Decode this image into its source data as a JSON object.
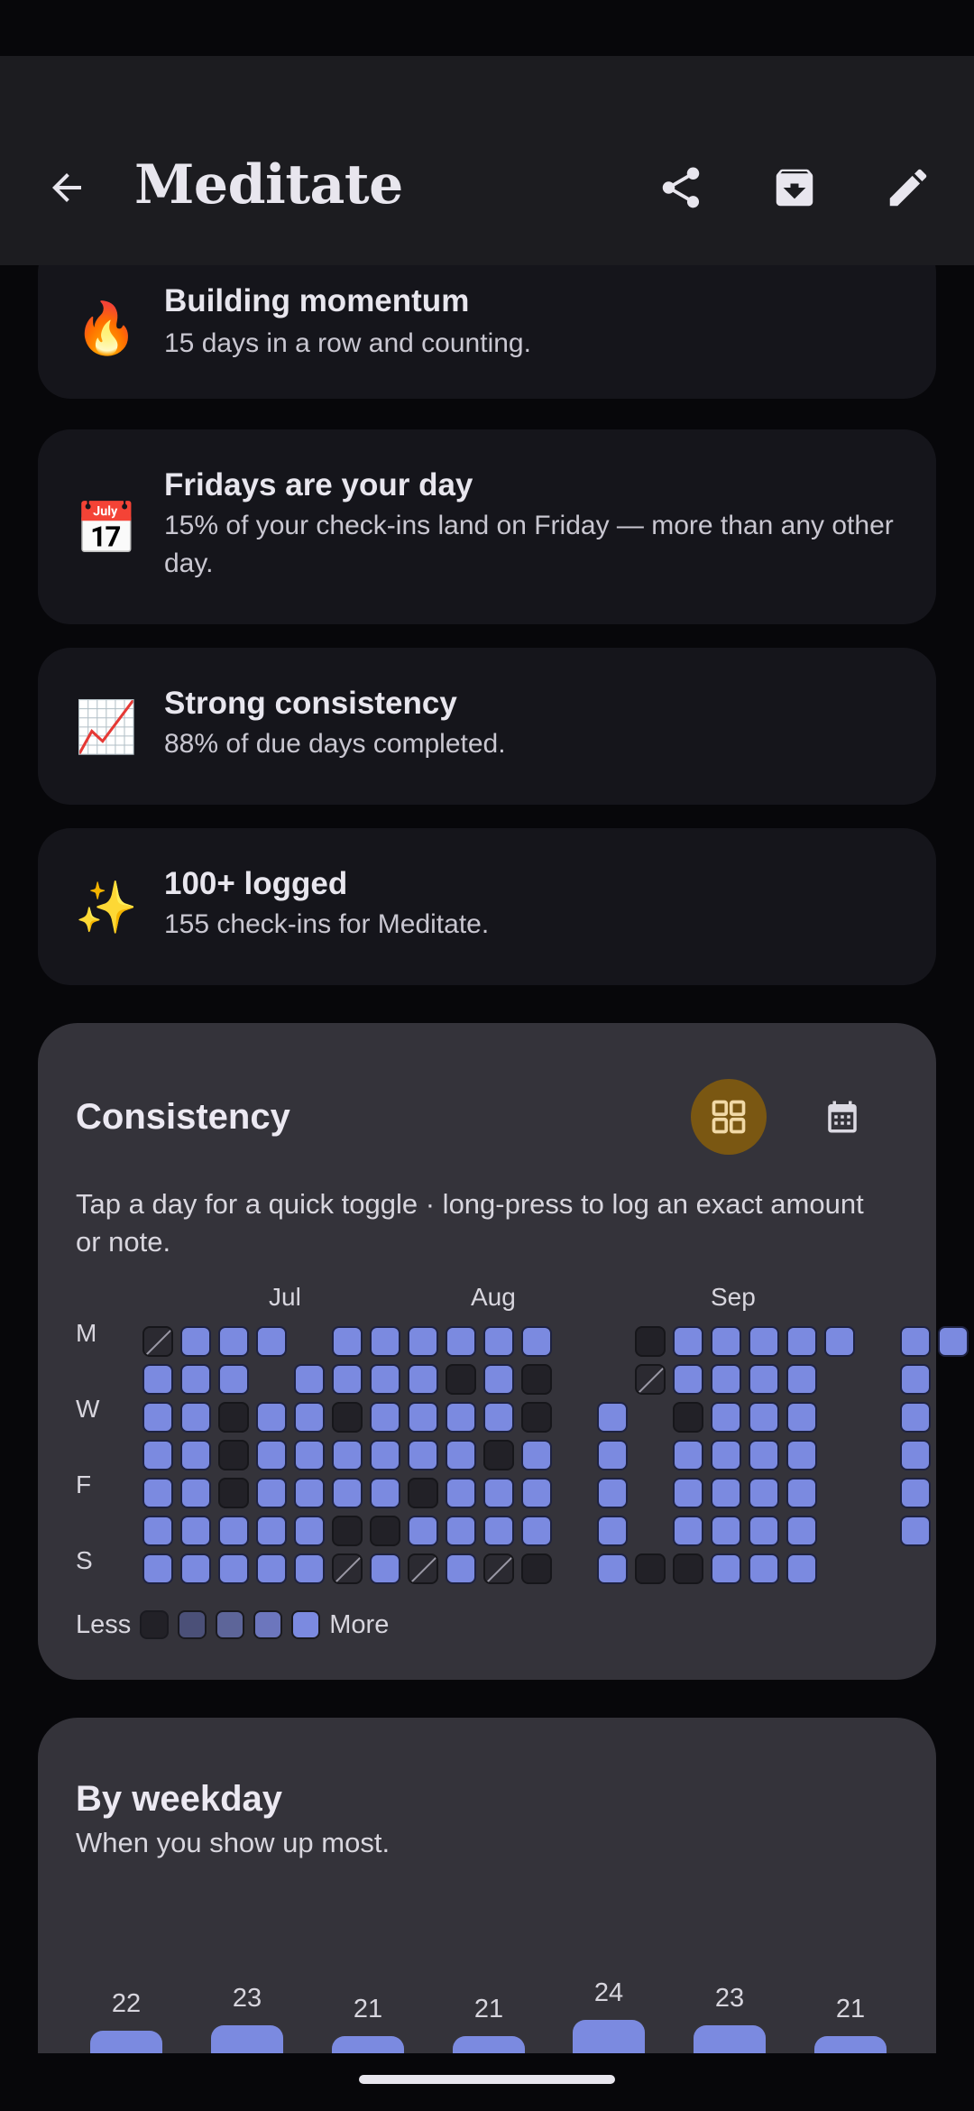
{
  "app_bar": {
    "title": "Meditate",
    "back_icon": "arrow-back-icon",
    "actions": [
      "share-icon",
      "archive-icon",
      "edit-icon"
    ]
  },
  "insights": [
    {
      "icon": "fire-icon",
      "emoji": "🔥",
      "title": "Building momentum",
      "desc": "15 days in a row and counting."
    },
    {
      "icon": "calendar-icon",
      "emoji": "📅",
      "title": "Fridays are your day",
      "desc": "15% of your check-ins land on Friday — more than any other day."
    },
    {
      "icon": "chart-up-icon",
      "emoji": "📈",
      "title": "Strong consistency",
      "desc": "88% of due days completed."
    },
    {
      "icon": "sparkles-icon",
      "emoji": "✨",
      "title": "100+ logged",
      "desc": "155 check-ins for Meditate."
    }
  ],
  "consistency": {
    "title": "Consistency",
    "desc": "Tap a day for a quick toggle · long-press to log an exact amount or note.",
    "view_modes": [
      "grid-view-icon",
      "calendar-view-icon"
    ],
    "selected_view": "grid-view-icon",
    "months": [
      "Jul",
      "Aug",
      "Sep"
    ],
    "day_labels": [
      "M",
      "",
      "W",
      "",
      "F",
      "",
      "S"
    ],
    "heatmap_weeks": [
      "sffffff",
      "fffffff",
      "ffeeeff",
      "f-fffff",
      "-ffffff",
      "ffeffes",
      "fffffef",
      "ffffefs",
      "fefffff",
      "fffeffs",
      "feefffe",
      "------",
      "--fffff",
      "es----e",
      "ffefffe",
      "fffffff",
      "fffffff",
      "fffffff",
      "f------",
      "-------",
      "ffffff",
      "f------"
    ],
    "legend": {
      "less": "Less",
      "more": "More",
      "shades": [
        "#222127",
        "#4b5078",
        "#5d6599",
        "#6c76bd",
        "#7b8ae0"
      ]
    }
  },
  "by_weekday": {
    "title": "By weekday",
    "subtitle": "When you show up most."
  },
  "chart_data": {
    "type": "bar",
    "title": "By weekday",
    "subtitle": "When you show up most.",
    "categories": [
      "",
      "",
      "",
      "",
      "",
      "",
      ""
    ],
    "values": [
      22,
      23,
      21,
      21,
      24,
      23,
      21
    ],
    "color": "#7b8ae0"
  }
}
